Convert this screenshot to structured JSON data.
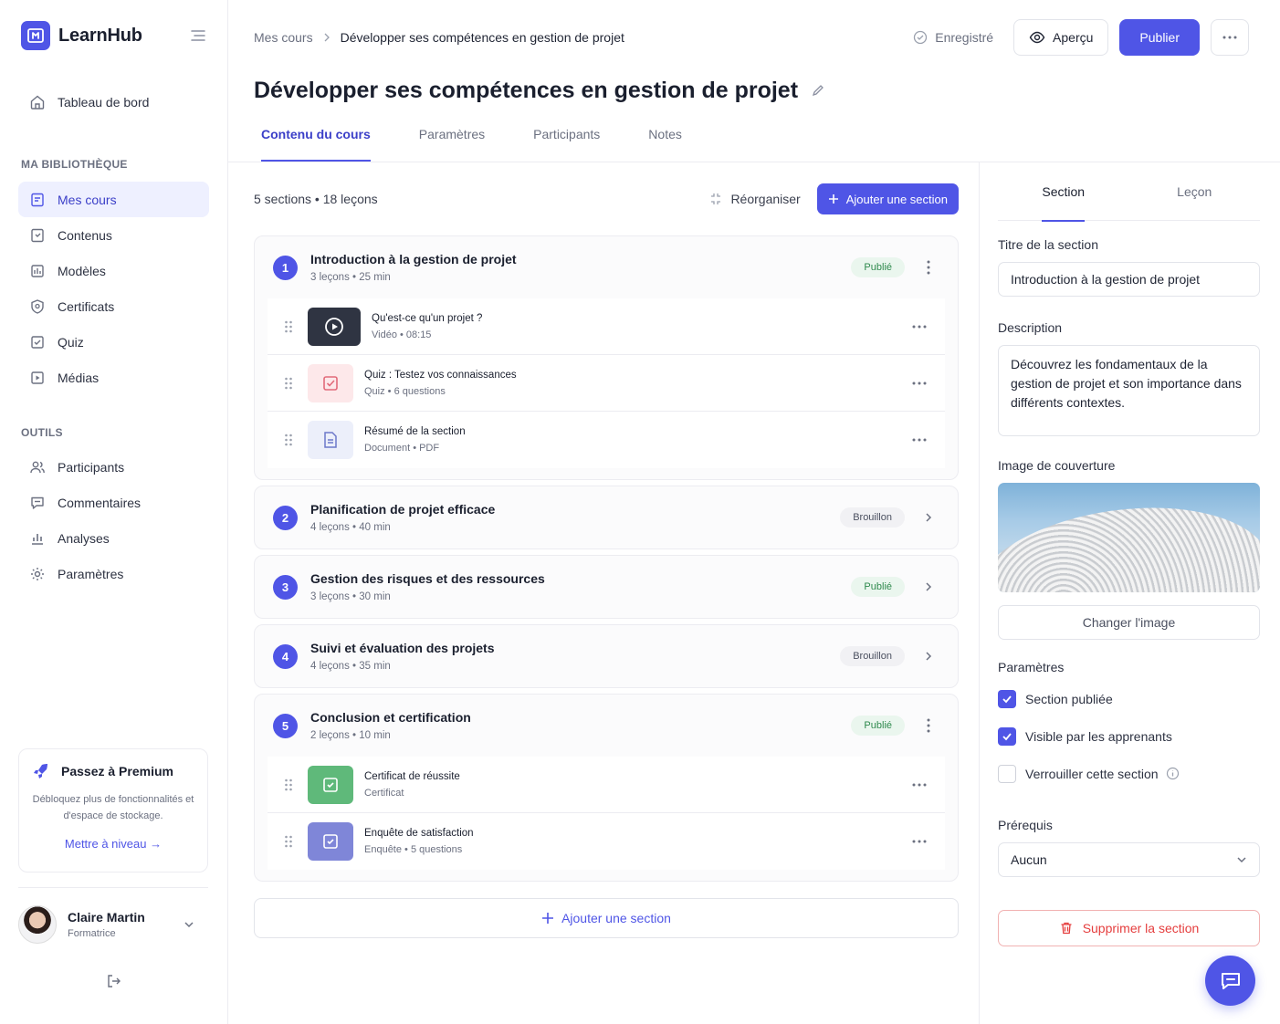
{
  "brand": {
    "name": "LearnHub",
    "accent": "#4f55e6"
  },
  "sidebar": {
    "dashboard": "Tableau de bord",
    "library_title": "MA BIBLIOTHÈQUE",
    "library": [
      {
        "label": "Mes cours",
        "icon": "book-icon",
        "active": true
      },
      {
        "label": "Contenus",
        "icon": "file-icon"
      },
      {
        "label": "Modèles",
        "icon": "template-icon"
      },
      {
        "label": "Certificats",
        "icon": "certificate-icon"
      },
      {
        "label": "Quiz",
        "icon": "quiz-icon"
      },
      {
        "label": "Médias",
        "icon": "media-icon"
      }
    ],
    "tools_title": "OUTILS",
    "tools": [
      {
        "label": "Participants",
        "icon": "users-icon"
      },
      {
        "label": "Commentaires",
        "icon": "comment-icon"
      },
      {
        "label": "Analyses",
        "icon": "chart-icon"
      },
      {
        "label": "Paramètres",
        "icon": "gear-icon"
      }
    ],
    "promo": {
      "title": "Passez à Premium",
      "description": "Débloquez plus de fonctionnalités et d'espace de stockage.",
      "link": "Mettre à niveau →"
    },
    "user": {
      "name": "Claire Martin",
      "role": "Formatrice"
    }
  },
  "topbar": {
    "breadcrumb": [
      "Mes cours",
      "Développer ses compétences en gestion de projet"
    ],
    "saved": "Enregistré",
    "preview": "Aperçu",
    "publish": "Publier"
  },
  "page_title": "Développer ses compétences en gestion de projet",
  "tabs": [
    {
      "label": "Contenu du cours",
      "active": true
    },
    {
      "label": "Paramètres"
    },
    {
      "label": "Participants"
    },
    {
      "label": "Notes"
    }
  ],
  "content": {
    "summary": "5 sections • 18 leçons",
    "reorder": "Réorganiser",
    "add_section": "Ajouter une section",
    "sections": [
      {
        "num": "1",
        "title": "Introduction à la gestion de projet",
        "meta": "3 leçons • 25 min",
        "status": "Publié",
        "expanded": true,
        "lessons": [
          {
            "title": "Qu'est-ce qu'un projet ?",
            "meta": "Vidéo • 08:15",
            "kind": "video"
          },
          {
            "title": "Quiz : Testez vos connaissances",
            "meta": "Quiz • 6 questions",
            "kind": "quiz"
          },
          {
            "title": "Résumé de la section",
            "meta": "Document • PDF",
            "kind": "doc"
          }
        ]
      },
      {
        "num": "2",
        "title": "Planification de projet efficace",
        "meta": "4 leçons • 40 min",
        "status": "Brouillon"
      },
      {
        "num": "3",
        "title": "Gestion des risques et des ressources",
        "meta": "3 leçons • 30 min",
        "status": "Publié"
      },
      {
        "num": "4",
        "title": "Suivi et évaluation des projets",
        "meta": "4 leçons • 35 min",
        "status": "Brouillon"
      },
      {
        "num": "5",
        "title": "Conclusion et certification",
        "meta": "2 leçons • 10 min",
        "status": "Publié",
        "expanded": true,
        "lessons": [
          {
            "title": "Certificat de réussite",
            "meta": "Certificat",
            "kind": "cert"
          },
          {
            "title": "Enquête de satisfaction",
            "meta": "Enquête • 5 questions",
            "kind": "survey"
          }
        ]
      }
    ],
    "add_section_bottom": "Ajouter une section"
  },
  "panel": {
    "tabs": [
      "Section",
      "Leçon"
    ],
    "title_label": "Titre de la section",
    "title_value": "Introduction à la gestion de projet",
    "desc_label": "Description",
    "desc_value": "Découvrez les fondamentaux de la gestion de projet et son importance dans différents contextes.",
    "cover_label": "Image de couverture",
    "change_image": "Changer l'image",
    "settings_label": "Paramètres",
    "checks": [
      {
        "label": "Section publiée",
        "checked": true
      },
      {
        "label": "Visible par les apprenants",
        "checked": true
      },
      {
        "label": "Verrouiller cette section",
        "checked": false
      }
    ],
    "prereq_label": "Prérequis",
    "prereq_value": "Aucun",
    "delete": "Supprimer la section"
  }
}
